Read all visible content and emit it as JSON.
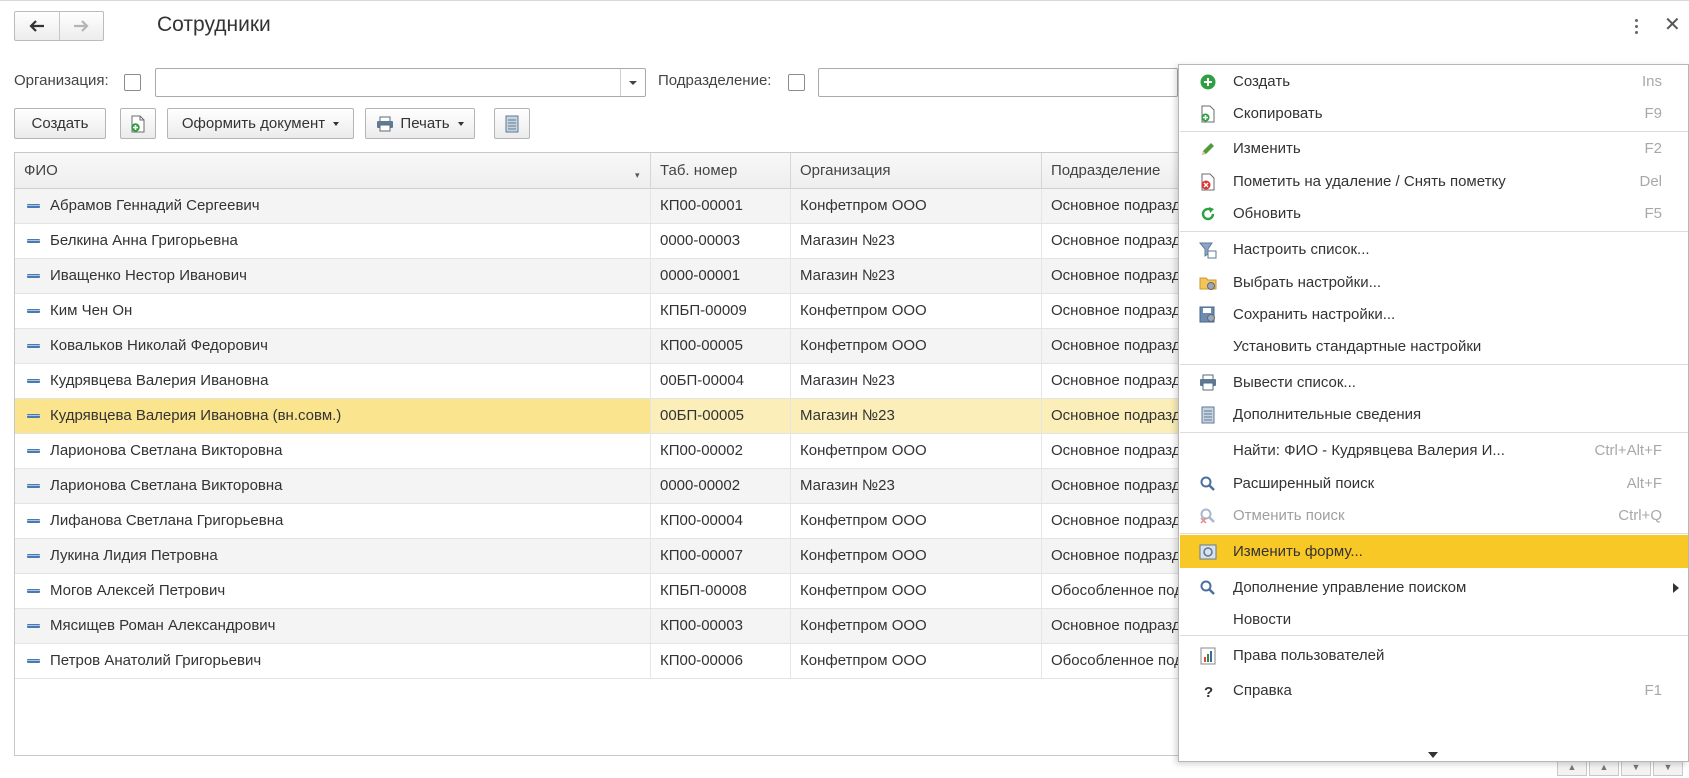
{
  "window": {
    "title": "Сотрудники"
  },
  "filters": {
    "org_label": "Организация:",
    "org_value": "",
    "dept_label": "Подразделение:",
    "dept_value": ""
  },
  "toolbar": {
    "create_label": "Создать",
    "document_label": "Оформить документ",
    "print_label": "Печать"
  },
  "table": {
    "columns": [
      "ФИО",
      "Таб. номер",
      "Организация",
      "Подразделение"
    ],
    "rows": [
      {
        "name": "Абрамов Геннадий Сергеевич",
        "tab": "КП00-00001",
        "org": "Конфетпром ООО",
        "dept": "Основное подразделение"
      },
      {
        "name": "Белкина Анна Григорьевна",
        "tab": "0000-00003",
        "org": "Магазин №23",
        "dept": "Основное подразделение"
      },
      {
        "name": "Иващенко Нестор Иванович",
        "tab": "0000-00001",
        "org": "Магазин №23",
        "dept": "Основное подразделение"
      },
      {
        "name": "Ким Чен Он",
        "tab": "КПБП-00009",
        "org": "Конфетпром ООО",
        "dept": "Основное подразделение"
      },
      {
        "name": "Ковальков Николай Федорович",
        "tab": "КП00-00005",
        "org": "Конфетпром ООО",
        "dept": "Основное подразделение"
      },
      {
        "name": "Кудрявцева Валерия Ивановна",
        "tab": "00БП-00004",
        "org": "Магазин №23",
        "dept": "Основное подразделение"
      },
      {
        "name": "Кудрявцева Валерия Ивановна (вн.совм.)",
        "tab": "00БП-00005",
        "org": "Магазин №23",
        "dept": "Основное подразделение"
      },
      {
        "name": "Ларионова Светлана Викторовна",
        "tab": "КП00-00002",
        "org": "Конфетпром ООО",
        "dept": "Основное подразделение"
      },
      {
        "name": "Ларионова Светлана Викторовна",
        "tab": "0000-00002",
        "org": "Магазин №23",
        "dept": "Основное подразделение"
      },
      {
        "name": "Лифанова Светлана Григорьевна",
        "tab": "КП00-00004",
        "org": "Конфетпром ООО",
        "dept": "Основное подразделение"
      },
      {
        "name": "Лукина Лидия Петровна",
        "tab": "КП00-00007",
        "org": "Конфетпром ООО",
        "dept": "Основное подразделение"
      },
      {
        "name": "Могов Алексей Петрович",
        "tab": "КПБП-00008",
        "org": "Конфетпром ООО",
        "dept": "Обособленное подразделение"
      },
      {
        "name": "Мясищев Роман Александрович",
        "tab": "КП00-00003",
        "org": "Конфетпром ООО",
        "dept": "Основное подразделение"
      },
      {
        "name": "Петров Анатолий Григорьевич",
        "tab": "КП00-00006",
        "org": "Конфетпром ООО",
        "dept": "Обособленное подразделение"
      }
    ],
    "selected_row": 6
  },
  "context_menu": {
    "items": [
      {
        "label": "Создать",
        "shortcut": "Ins",
        "icon": "plus-circle-icon"
      },
      {
        "label": "Скопировать",
        "shortcut": "F9",
        "icon": "copy-icon"
      },
      {
        "label": "Изменить",
        "shortcut": "F2",
        "icon": "pencil-icon"
      },
      {
        "label": "Пометить на удаление / Снять пометку",
        "shortcut": "Del",
        "icon": "delete-mark-icon"
      },
      {
        "label": "Обновить",
        "shortcut": "F5",
        "icon": "refresh-icon"
      },
      {
        "label": "Настроить список...",
        "shortcut": "",
        "icon": "list-settings-icon"
      },
      {
        "label": "Выбрать настройки...",
        "shortcut": "",
        "icon": "folder-settings-icon"
      },
      {
        "label": "Сохранить настройки...",
        "shortcut": "",
        "icon": "save-settings-icon"
      },
      {
        "label": "Установить стандартные настройки",
        "shortcut": "",
        "icon": ""
      },
      {
        "label": "Вывести список...",
        "shortcut": "",
        "icon": "print-list-icon"
      },
      {
        "label": "Дополнительные сведения",
        "shortcut": "",
        "icon": "document-icon"
      },
      {
        "label": "Найти: ФИО - Кудрявцева Валерия И...",
        "shortcut": "Ctrl+Alt+F",
        "icon": ""
      },
      {
        "label": "Расширенный поиск",
        "shortcut": "Alt+F",
        "icon": "search-icon"
      },
      {
        "label": "Отменить поиск",
        "shortcut": "Ctrl+Q",
        "icon": "cancel-search-icon"
      },
      {
        "label": "Изменить форму...",
        "shortcut": "",
        "icon": "form-edit-icon"
      },
      {
        "label": "Дополнение управление поиском",
        "shortcut": "",
        "icon": "search-icon"
      },
      {
        "label": "Новости",
        "shortcut": "",
        "icon": ""
      },
      {
        "label": "Права пользователей",
        "shortcut": "",
        "icon": "chart-icon"
      },
      {
        "label": "Справка",
        "shortcut": "F1",
        "icon": "help-icon"
      }
    ],
    "highlighted_index": 14,
    "disabled_index": 13
  },
  "colors": {
    "selected_row": "#fbeeb8",
    "selected_cell": "#fbe48e",
    "menu_highlight": "#f8c826"
  }
}
